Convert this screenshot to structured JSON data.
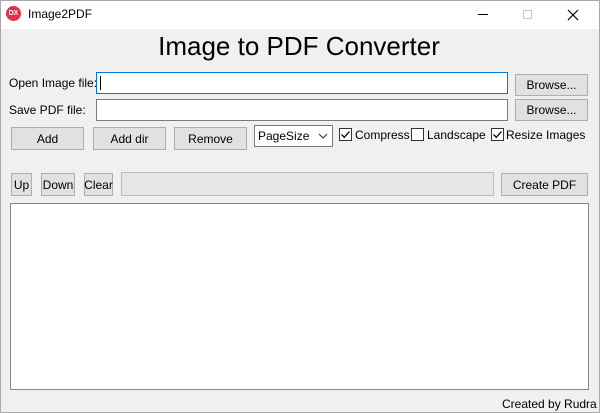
{
  "window": {
    "title": "Image2PDF",
    "app_icon_text": "DX",
    "minimize_icon": "minimize-icon",
    "maximize_icon": "maximize-icon",
    "close_icon": "close-icon"
  },
  "heading": "Image to PDF Converter",
  "open_image": {
    "label": "Open Image file:",
    "value": "",
    "browse_label": "Browse..."
  },
  "save_pdf": {
    "label": "Save PDF file:",
    "value": "",
    "browse_label": "Browse..."
  },
  "toolbar": {
    "add_label": "Add",
    "add_dir_label": "Add dir",
    "remove_label": "Remove",
    "page_size_value": "PageSize",
    "compress": {
      "label": "Compress",
      "checked": true
    },
    "landscape": {
      "label": "Landscape",
      "checked": false
    },
    "resize_images": {
      "label": "Resize Images",
      "checked": true
    }
  },
  "list_controls": {
    "up_label": "Up",
    "down_label": "Down",
    "clear_label": "Clear",
    "progress": 0,
    "create_pdf_label": "Create PDF"
  },
  "image_list": [],
  "footer": "Created by Rudra"
}
